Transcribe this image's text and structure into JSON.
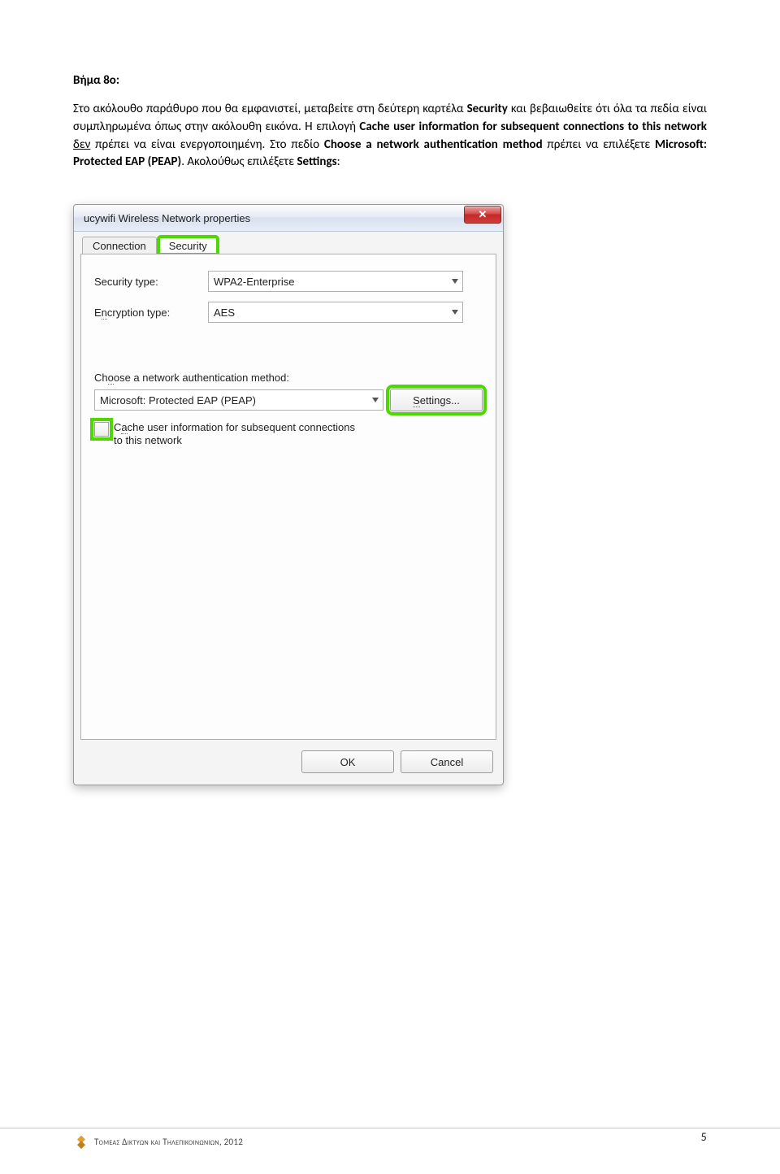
{
  "heading": "Βήμα 8ο:",
  "paragraph": {
    "p1a": "Στο ακόλουθο παράθυρο που θα εμφανιστεί, μεταβείτε στη δεύτερη καρτέλα ",
    "p1b": "Security",
    "p1c": " και βεβαιωθείτε ότι όλα τα πεδία είναι συμπληρωμένα όπως στην ακόλουθη εικόνα. Η επιλογή ",
    "p1d": "Cache user information for subsequent connections to this network",
    "p1e_u": "δεν",
    "p1f": " πρέπει να είναι ενεργοποιημένη. Στο πεδίο ",
    "p1g": "Choose a network authentication method",
    "p1h": " πρέπει να επιλέξετε ",
    "p1i": "Microsoft: Protected EAP (PEAP)",
    "p1j": ". Ακολούθως επιλέξετε ",
    "p1k": "Settings",
    "p1l": ":"
  },
  "dialog": {
    "title": "ucywifi Wireless Network properties",
    "close": "✕",
    "tabs": {
      "connection": "Connection",
      "security": "Security"
    },
    "security_type_label": "Security type:",
    "security_type_value": "WPA2-Enterprise",
    "encryption_label": "Encryption type:",
    "encryption_value": "AES",
    "auth_method_label": "Choose a network authentication method:",
    "auth_method_value": "Microsoft: Protected EAP (PEAP)",
    "settings_btn": "Settings...",
    "cache_label_l1": "Cache user information for subsequent connections",
    "cache_label_l2": "to this network",
    "ok": "OK",
    "cancel": "Cancel"
  },
  "footer": {
    "text": "Τομεας Δικτυων και Τηλεπικοινωνιων, 2012",
    "page": "5"
  }
}
